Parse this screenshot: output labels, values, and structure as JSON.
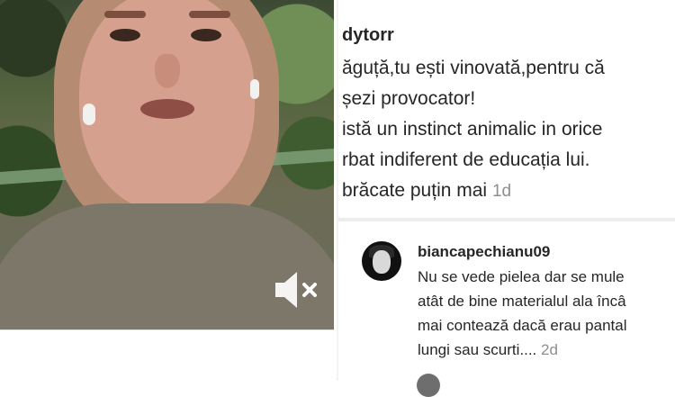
{
  "video": {
    "muted": true,
    "icon": "volume-muted-icon"
  },
  "comment1": {
    "username": "dytorr",
    "lines": [
      "ăguță,tu ești vinovată,pentru că",
      "șezi provocator!",
      "istă un instinct animalic in orice",
      "rbat indiferent de educația lui.",
      "brăcate puțin mai"
    ],
    "time": "1d"
  },
  "comment2": {
    "username": "biancapechianu09",
    "lines": [
      "Nu se vede pielea dar se mule",
      "atât de bine materialul ala încâ",
      "mai contează dacă erau pantal",
      "lungi sau scurti...."
    ],
    "time": "2d"
  },
  "colors": {
    "text": "#262626",
    "meta": "#8e8e8e",
    "separator": "#ededed"
  }
}
